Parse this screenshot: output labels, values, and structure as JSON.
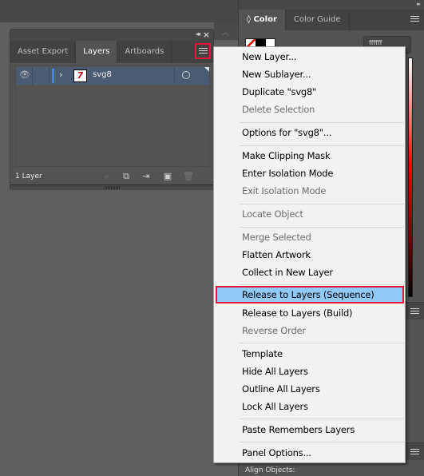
{
  "layers_panel": {
    "tabs": [
      {
        "label": "Asset Export",
        "active": false
      },
      {
        "label": "Layers",
        "active": true
      },
      {
        "label": "Artboards",
        "active": false
      }
    ],
    "header_icons": {
      "collapse": "double-left-arrow-icon",
      "close": "close-icon",
      "menu": "hamburger-menu-icon"
    },
    "layers": [
      {
        "name": "svg8",
        "visible": true,
        "color": "#4f7cff",
        "expanded": false,
        "thumbnail_text": "7"
      }
    ],
    "footer": {
      "count_label": "1 Layer",
      "icons": [
        "locate-object-icon",
        "make-clipping-mask-icon",
        "create-sublayer-icon",
        "create-layer-icon",
        "delete-icon"
      ]
    }
  },
  "right_panel": {
    "tabs": [
      {
        "label": "Color",
        "active": true,
        "prefix": "◊"
      },
      {
        "label": "Color Guide",
        "active": false
      }
    ],
    "hex_value": "ffffff",
    "partial_label": "Align Objects:"
  },
  "context_menu": {
    "items": [
      {
        "label": "New Layer...",
        "enabled": true
      },
      {
        "label": "New Sublayer...",
        "enabled": true
      },
      {
        "label": "Duplicate \"svg8\"",
        "enabled": true
      },
      {
        "label": "Delete Selection",
        "enabled": false
      },
      {
        "separator": true
      },
      {
        "label": "Options for \"svg8\"...",
        "enabled": true
      },
      {
        "separator": true
      },
      {
        "label": "Make Clipping Mask",
        "enabled": true
      },
      {
        "label": "Enter Isolation Mode",
        "enabled": true
      },
      {
        "label": "Exit Isolation Mode",
        "enabled": false
      },
      {
        "separator": true
      },
      {
        "label": "Locate Object",
        "enabled": false
      },
      {
        "separator": true
      },
      {
        "label": "Merge Selected",
        "enabled": false
      },
      {
        "label": "Flatten Artwork",
        "enabled": true
      },
      {
        "label": "Collect in New Layer",
        "enabled": true
      },
      {
        "separator": true
      },
      {
        "label": "Release to Layers (Sequence)",
        "enabled": true,
        "highlighted": true
      },
      {
        "label": "Release to Layers (Build)",
        "enabled": true
      },
      {
        "label": "Reverse Order",
        "enabled": false
      },
      {
        "separator": true
      },
      {
        "label": "Template",
        "enabled": true
      },
      {
        "label": "Hide All Layers",
        "enabled": true
      },
      {
        "label": "Outline All Layers",
        "enabled": true
      },
      {
        "label": "Lock All Layers",
        "enabled": true
      },
      {
        "separator": true
      },
      {
        "label": "Paste Remembers Layers",
        "enabled": true
      },
      {
        "separator": true
      },
      {
        "label": "Panel Options...",
        "enabled": true
      }
    ]
  },
  "colors": {
    "highlight_bg": "#91c9f7",
    "highlight_border": "#e8163a",
    "layer_color": "#4f7cff"
  }
}
